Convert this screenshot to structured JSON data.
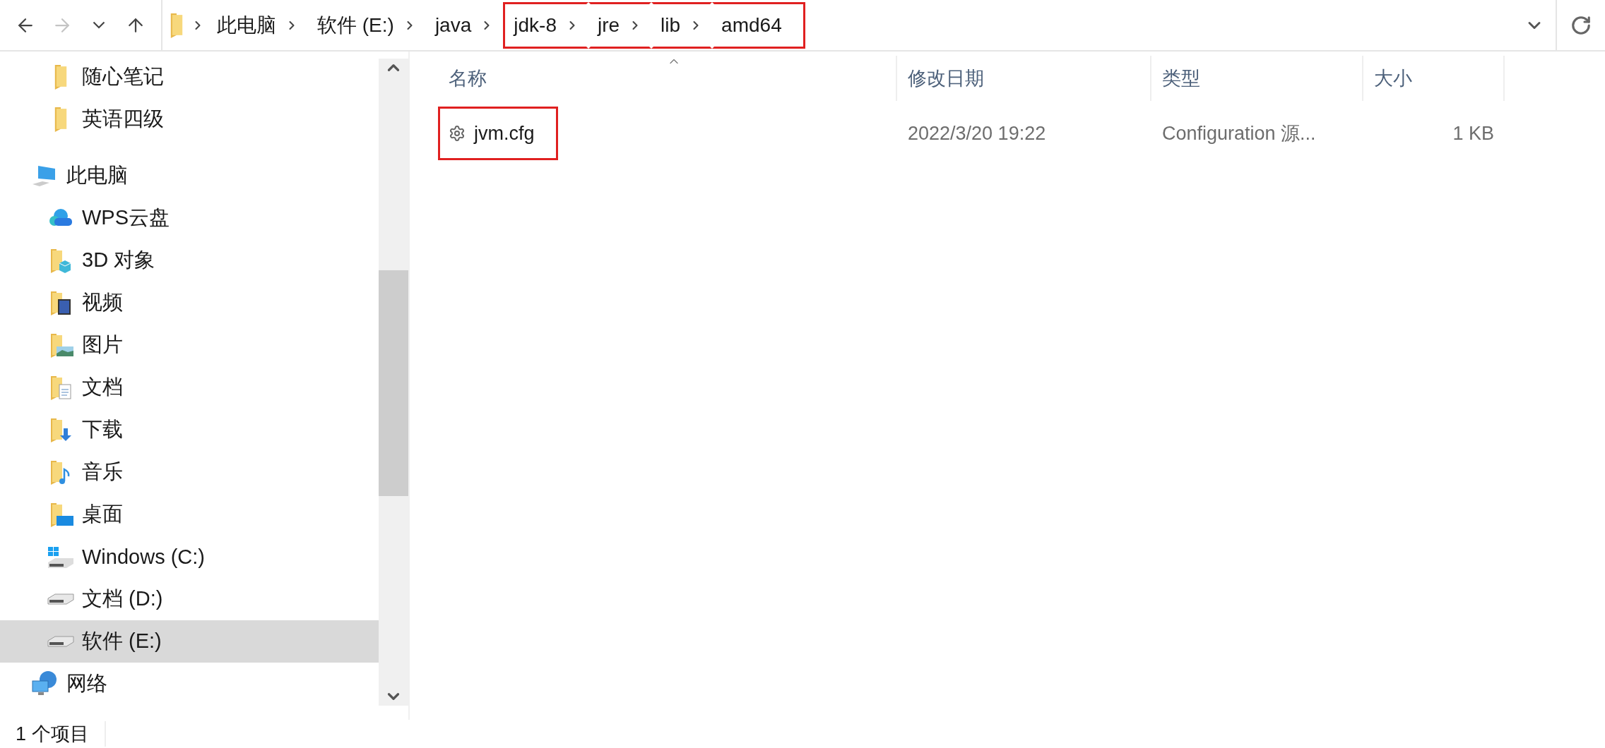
{
  "toolbar": {
    "nav": [
      {
        "kind": "back",
        "disabled": false
      },
      {
        "kind": "forward",
        "disabled": true
      },
      {
        "kind": "recent",
        "disabled": false
      },
      {
        "kind": "up",
        "disabled": false
      }
    ]
  },
  "address_bar": {
    "crumbs": [
      {
        "label": "此电脑",
        "highlighted": false
      },
      {
        "label": "软件 (E:)",
        "highlighted": false
      },
      {
        "label": "java",
        "highlighted": false
      },
      {
        "label": "jdk-8",
        "highlighted": true
      },
      {
        "label": "jre",
        "highlighted": true
      },
      {
        "label": "lib",
        "highlighted": true
      },
      {
        "label": "amd64",
        "highlighted": true
      }
    ]
  },
  "sidebar": {
    "pinned": [
      {
        "label": "随心笔记",
        "kind": "folder",
        "selected": false
      },
      {
        "label": "英语四级",
        "kind": "folder",
        "selected": false
      }
    ],
    "tree": [
      {
        "label": "此电脑",
        "kind": "pc",
        "selected": false,
        "children": [
          {
            "label": "WPS云盘",
            "kind": "cloud",
            "selected": false
          },
          {
            "label": "3D 对象",
            "kind": "cube",
            "selected": false
          },
          {
            "label": "视频",
            "kind": "video",
            "selected": false
          },
          {
            "label": "图片",
            "kind": "pictures",
            "selected": false
          },
          {
            "label": "文档",
            "kind": "docs",
            "selected": false
          },
          {
            "label": "下载",
            "kind": "downloads",
            "selected": false
          },
          {
            "label": "音乐",
            "kind": "music",
            "selected": false
          },
          {
            "label": "桌面",
            "kind": "desktop",
            "selected": false
          },
          {
            "label": "Windows (C:)",
            "kind": "windrive",
            "selected": false
          },
          {
            "label": "文档 (D:)",
            "kind": "drive",
            "selected": false
          },
          {
            "label": "软件 (E:)",
            "kind": "drive",
            "selected": true
          }
        ]
      },
      {
        "label": "网络",
        "kind": "network",
        "selected": false
      }
    ]
  },
  "file_list": {
    "columns": [
      {
        "label": "名称",
        "sorted": true
      },
      {
        "label": "修改日期",
        "sorted": false
      },
      {
        "label": "类型",
        "sorted": false
      },
      {
        "label": "大小",
        "sorted": false
      }
    ],
    "rows": [
      {
        "name": "jvm.cfg",
        "modified": "2022/3/20 19:22",
        "type": "Configuration 源...",
        "size": "1 KB",
        "highlighted": true
      }
    ]
  },
  "status_bar": {
    "item_count": "1 个项目"
  }
}
